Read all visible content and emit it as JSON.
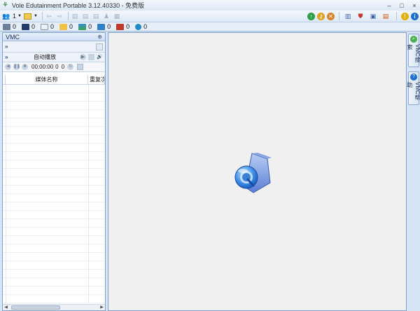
{
  "window": {
    "title": "Vole Edutainment Portable  3.12.40330 - 免费版",
    "minimize": "–",
    "maximize": "□",
    "close": "×"
  },
  "toolbar": {
    "profile_count": "1"
  },
  "counters": [
    "0",
    "0",
    "0",
    "0",
    "0",
    "0",
    "0",
    "0"
  ],
  "left_panel": {
    "title": "VMC",
    "autoplay_label": "自动播放",
    "time": "00:00:00",
    "num1": "0",
    "num2": "0",
    "columns": [
      "媒体名称",
      "重复次数"
    ]
  },
  "right_tabs": [
    "VMC搜索",
    "VMC帮助"
  ],
  "colors": {
    "accent": "#7f9fcc",
    "background": "#f0f0f0"
  }
}
